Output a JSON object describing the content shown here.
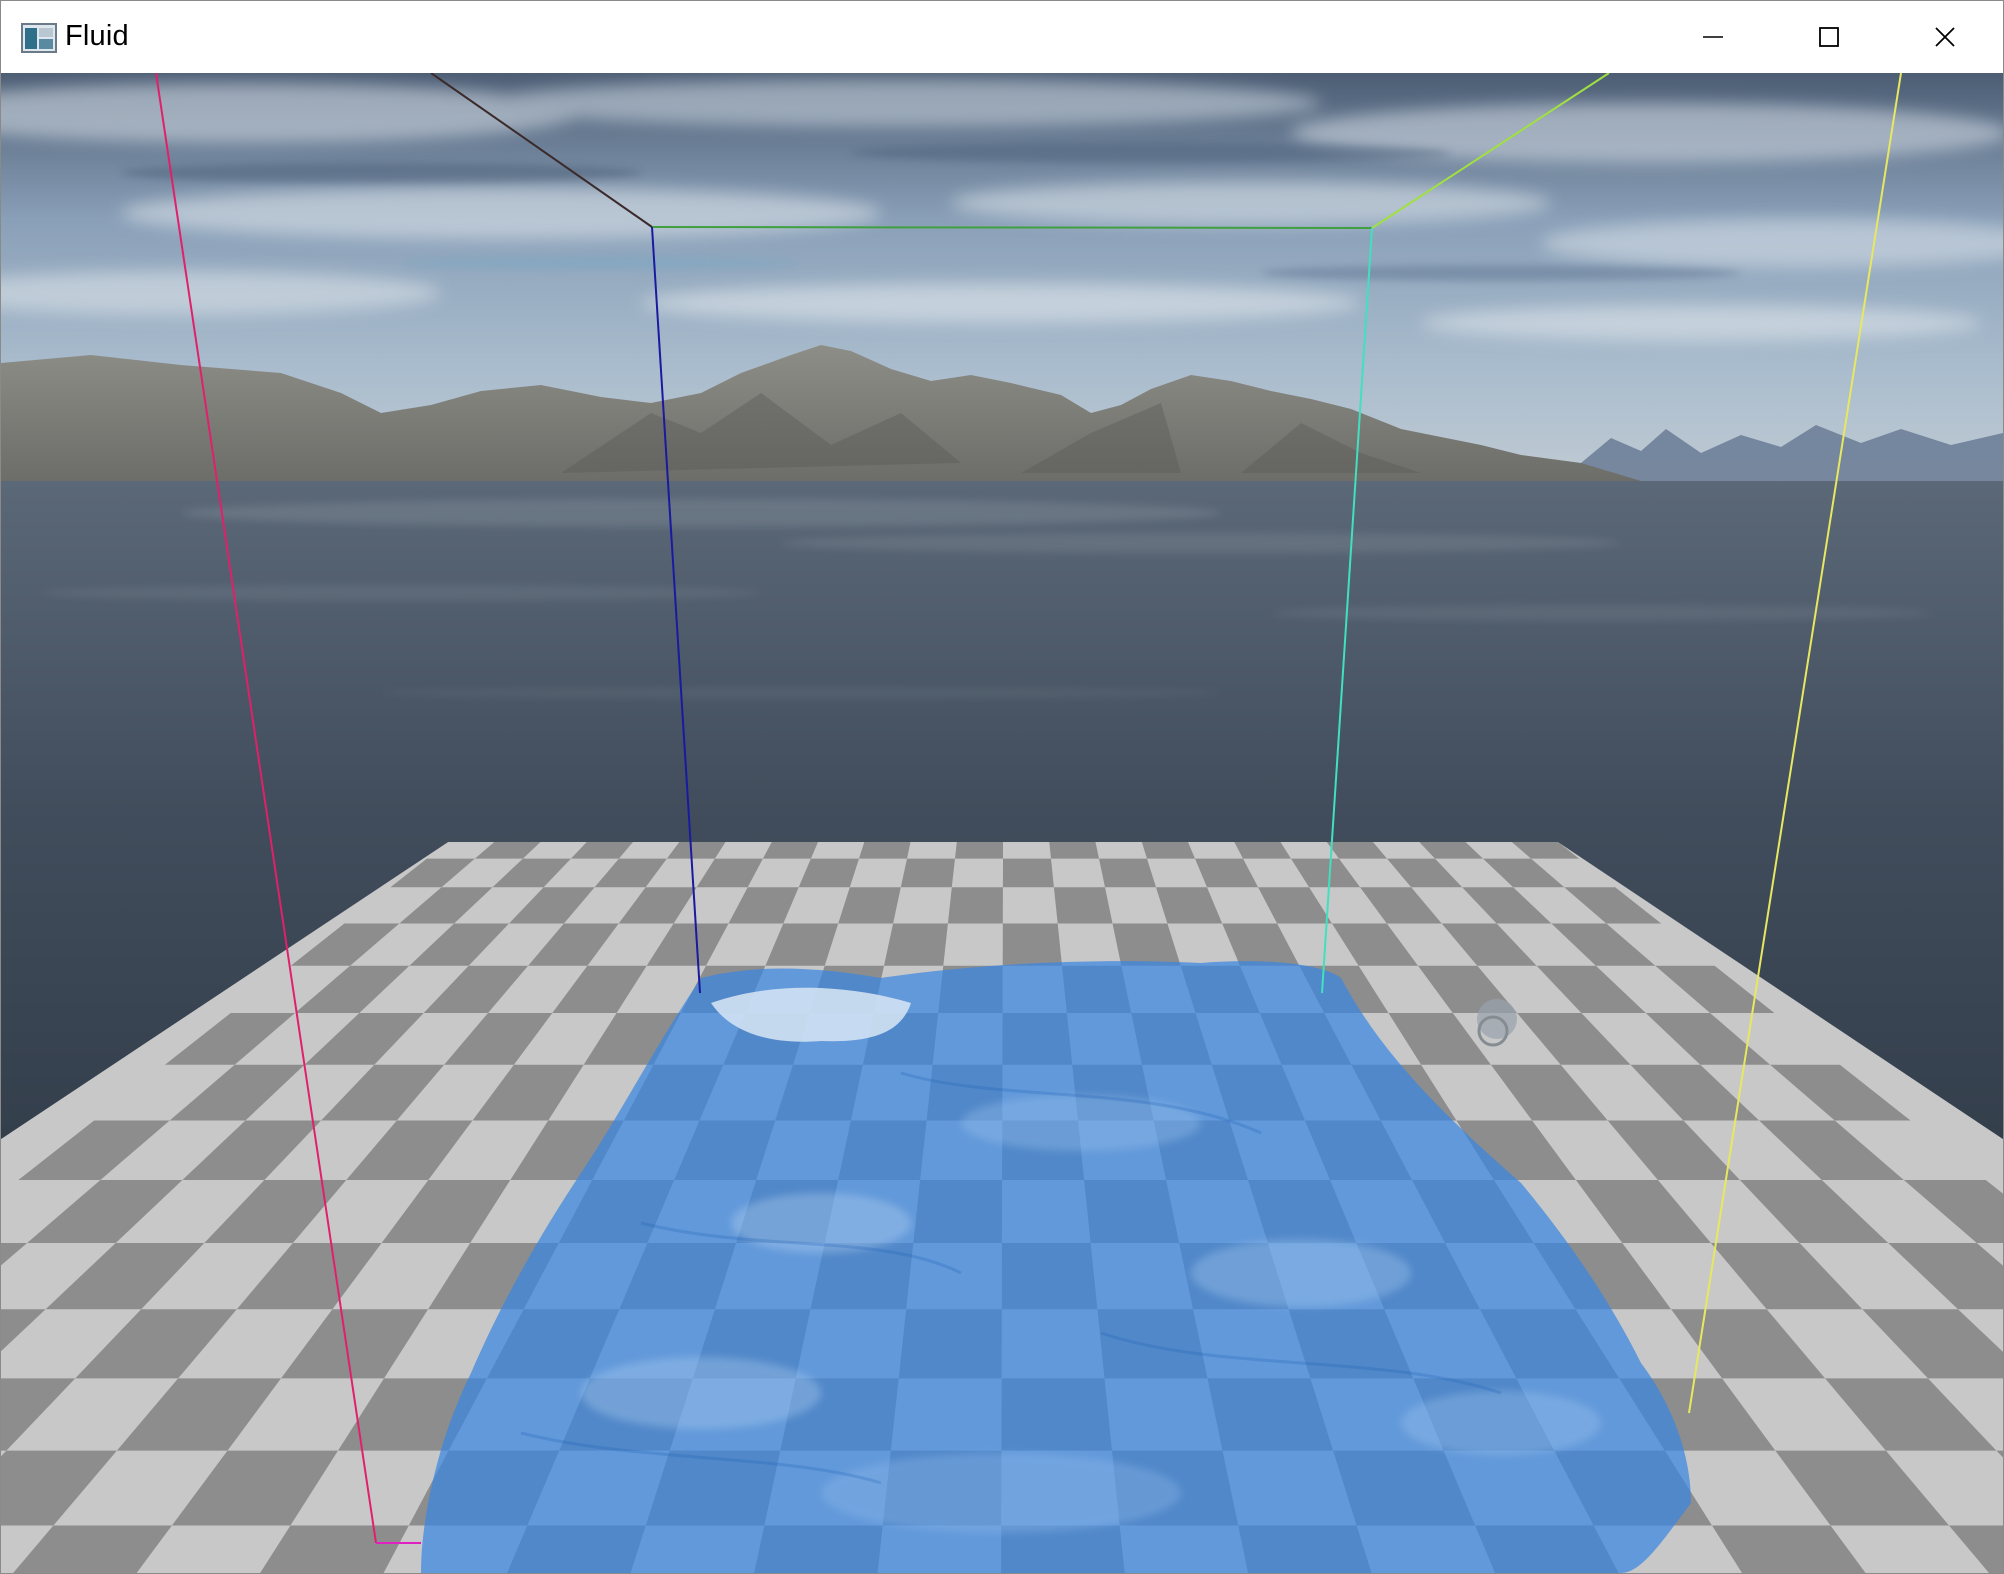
{
  "window": {
    "title": "Fluid",
    "icon": "app-window-icon",
    "controls": {
      "minimize": "minimize-icon",
      "maximize": "maximize-icon",
      "close": "close-icon"
    }
  },
  "scene": {
    "background": "skybox-mountains-lake",
    "ground": "checkerboard-plane",
    "fluid_color": "#3a86e0",
    "bounding_box_colors": [
      "#e0206a",
      "#2a2a2a",
      "#1a1aa0",
      "#40c040",
      "#a0e040",
      "#e0e040",
      "#40e0d0"
    ]
  }
}
